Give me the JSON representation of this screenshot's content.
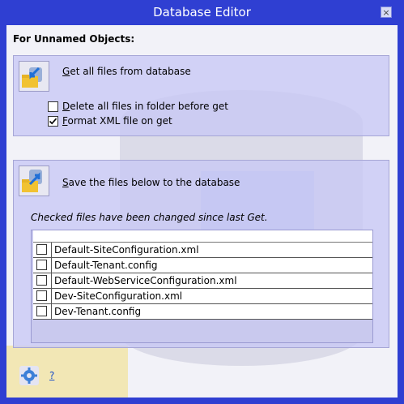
{
  "window": {
    "title": "Database Editor",
    "close_glyph": "×"
  },
  "main": {
    "heading": "For Unnamed Objects:",
    "get_section": {
      "icon": "database-get-icon",
      "label_accel": "G",
      "label_rest": "et all files from database",
      "options": [
        {
          "accel": "D",
          "rest": "elete all files in folder before get",
          "checked": false
        },
        {
          "accel": "F",
          "rest": "ormat XML file on get",
          "checked": true
        }
      ]
    },
    "save_section": {
      "icon": "database-save-icon",
      "label_accel": "S",
      "label_rest": "ave the files below to the database",
      "note": "Checked files have been changed since last Get.",
      "files": [
        {
          "name": "Default-SiteConfiguration.xml",
          "checked": false
        },
        {
          "name": "Default-Tenant.config",
          "checked": false
        },
        {
          "name": "Default-WebServiceConfiguration.xml",
          "checked": false
        },
        {
          "name": "Dev-SiteConfiguration.xml",
          "checked": false
        },
        {
          "name": "Dev-Tenant.config",
          "checked": false
        }
      ]
    }
  },
  "footer": {
    "settings_icon": "gear-icon",
    "help_label": "?"
  },
  "colors": {
    "title_bar": "#2f3fd2",
    "panel": "#c8c8f5",
    "link": "#1a4fc8"
  }
}
